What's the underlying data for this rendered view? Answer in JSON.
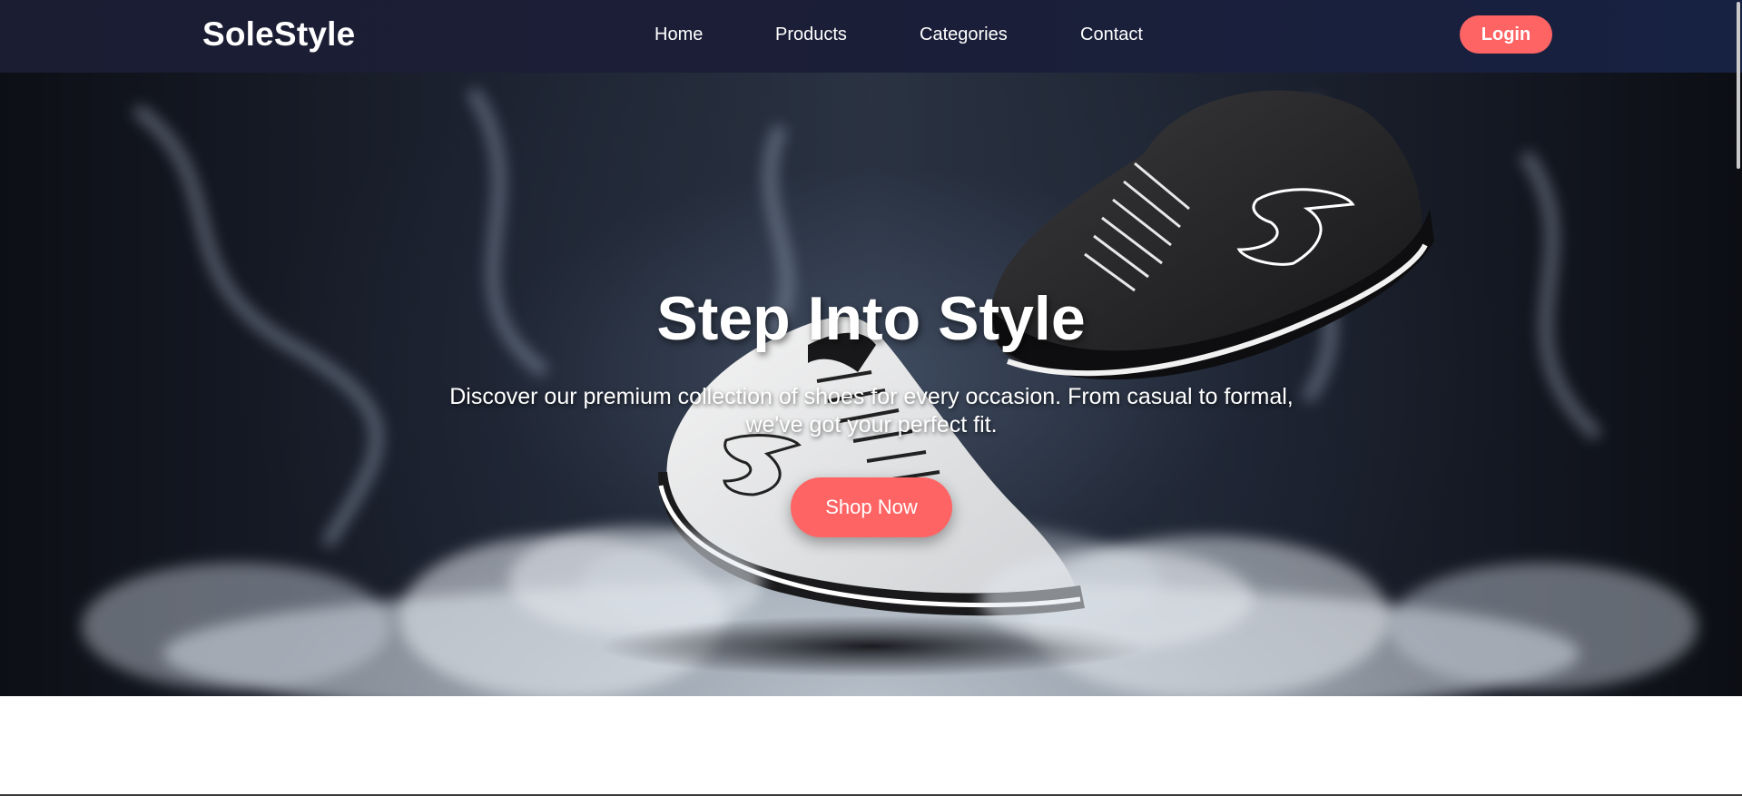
{
  "brand": {
    "name": "SoleStyle"
  },
  "nav": {
    "items": [
      {
        "label": "Home"
      },
      {
        "label": "Products"
      },
      {
        "label": "Categories"
      },
      {
        "label": "Contact"
      }
    ],
    "login_label": "Login"
  },
  "hero": {
    "title": "Step Into Style",
    "subtitle": "Discover our premium collection of shoes for every occasion. From casual to formal, we've got your perfect fit.",
    "cta_label": "Shop Now",
    "image_icon": "sneakers-smoke-image"
  },
  "colors": {
    "accent": "#ff6464",
    "nav_bg": "#1b1e37",
    "text": "#ffffff"
  }
}
